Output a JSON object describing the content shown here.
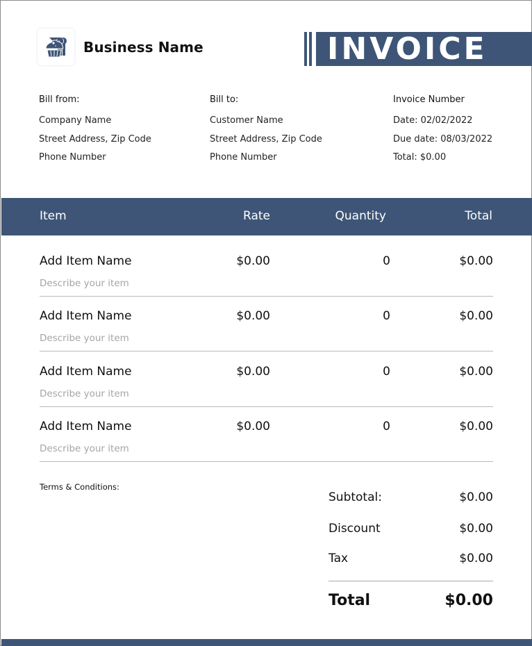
{
  "header": {
    "business_name": "Business Name",
    "logo_icon": "bakery-icon",
    "title": "INVOICE"
  },
  "bill_from": {
    "label": "Bill from:",
    "lines": [
      "Company Name",
      "Street Address, Zip Code",
      "Phone Number"
    ]
  },
  "bill_to": {
    "label": "Bill to:",
    "lines": [
      "Customer Name",
      "Street Address, Zip Code",
      "Phone Number"
    ]
  },
  "invoice_info": {
    "label": "Invoice Number",
    "lines": [
      "Date: 02/02/2022",
      "Due date: 08/03/2022",
      "Total: $0.00"
    ]
  },
  "table": {
    "columns": [
      "Item",
      "Rate",
      "Quantity",
      "Total"
    ],
    "rows": [
      {
        "name": "Add Item Name",
        "description": "Describe your item",
        "rate": "$0.00",
        "quantity": "0",
        "total": "$0.00"
      },
      {
        "name": "Add Item Name",
        "description": "Describe your item",
        "rate": "$0.00",
        "quantity": "0",
        "total": "$0.00"
      },
      {
        "name": "Add Item Name",
        "description": "Describe your item",
        "rate": "$0.00",
        "quantity": "0",
        "total": "$0.00"
      },
      {
        "name": "Add Item Name",
        "description": "Describe your item",
        "rate": "$0.00",
        "quantity": "0",
        "total": "$0.00"
      }
    ]
  },
  "terms": {
    "label": "Terms & Conditions:"
  },
  "summary": {
    "subtotal_label": "Subtotal:",
    "subtotal_value": "$0.00",
    "discount_label": "Discount",
    "discount_value": "$0.00",
    "tax_label": "Tax",
    "tax_value": "$0.00",
    "total_label": "Total",
    "total_value": "$0.00"
  },
  "colors": {
    "accent": "#3e5577"
  }
}
